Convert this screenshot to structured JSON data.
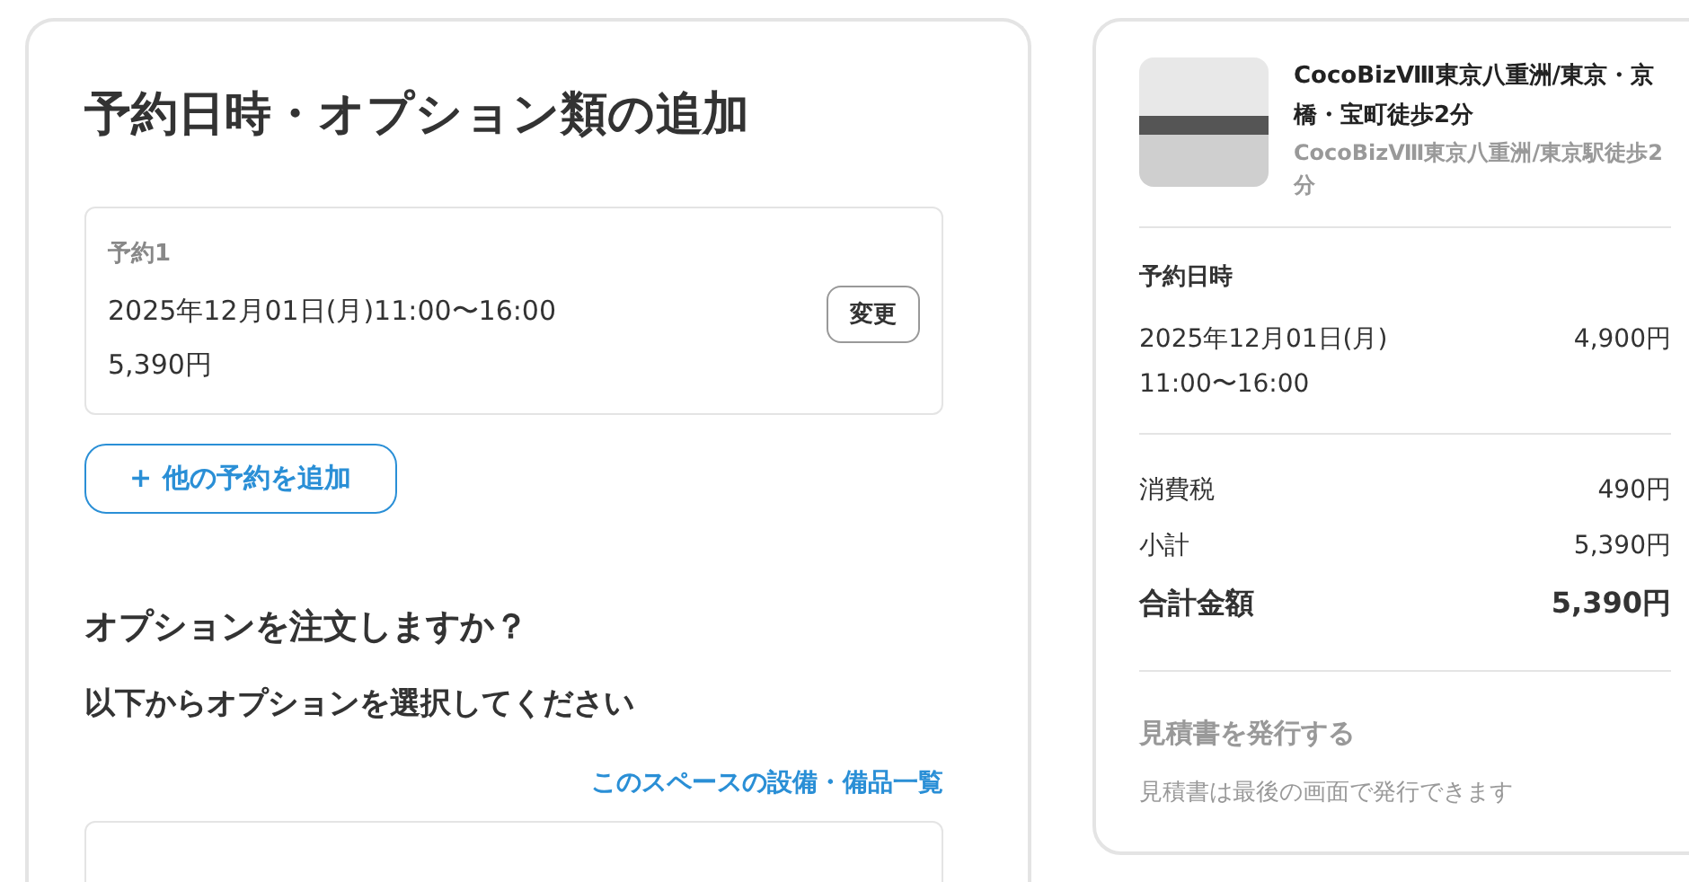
{
  "main": {
    "title": "予約日時・オプション類の追加",
    "reservations": [
      {
        "label": "予約1",
        "datetime": "2025年12月01日(月)11:00〜16:00",
        "price": "5,390円",
        "change_button": "変更"
      }
    ],
    "add_button": {
      "icon": "+",
      "label": "他の予約を追加"
    },
    "options_question": "オプションを注文しますか？",
    "options_instruction": "以下からオプションを選択してください",
    "equipment_link": "このスペースの設備・備品一覧"
  },
  "summary": {
    "space_name": "CocoBizⅧ東京八重洲/東京・京橋・宝町徒歩2分",
    "space_subtitle": "CocoBizⅧ東京八重洲/東京駅徒歩2分",
    "datetime_heading": "予約日時",
    "date": "2025年12月01日(月)",
    "time": "11:00〜16:00",
    "base_price": "4,900円",
    "lines": [
      {
        "label": "消費税",
        "value": "490円",
        "kind": "normal"
      },
      {
        "label": "小計",
        "value": "5,390円",
        "kind": "normal"
      },
      {
        "label": "合計金額",
        "value": "5,390円",
        "kind": "total"
      }
    ],
    "quote_button": "見積書を発行する",
    "quote_note": "見積書は最後の画面で発行できます"
  }
}
